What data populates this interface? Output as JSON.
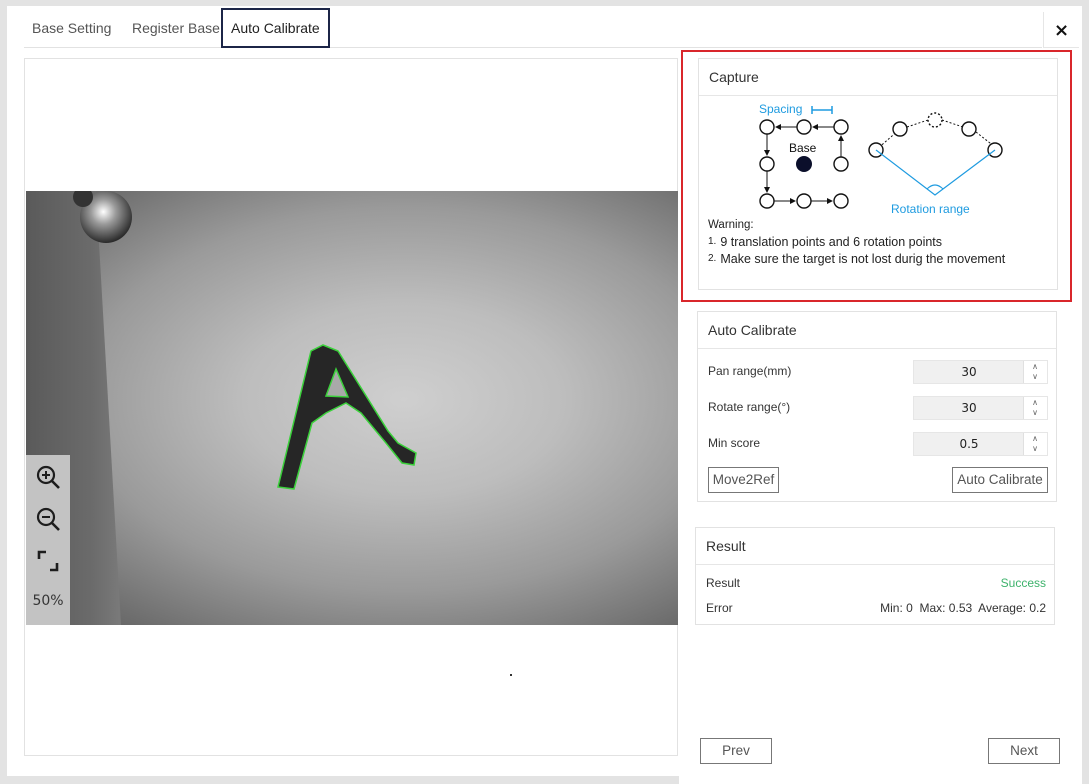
{
  "tabs": [
    {
      "label": "Base Setting"
    },
    {
      "label": "Register Base"
    },
    {
      "label": "Auto Calibrate"
    }
  ],
  "close_label": "×",
  "viewer": {
    "zoom_percent": "50%"
  },
  "capture": {
    "title": "Capture",
    "diagram": {
      "spacing_label": "Spacing",
      "base_label": "Base",
      "rotation_label": "Rotation range"
    },
    "warning_title": "Warning:",
    "warnings": [
      {
        "num": "1.",
        "text": "9 translation points and 6 rotation points"
      },
      {
        "num": "2.",
        "text": "Make sure the target is not lost durig the movement"
      }
    ]
  },
  "auto_calibrate": {
    "title": "Auto Calibrate",
    "fields": [
      {
        "label": "Pan range(mm)",
        "value": "30"
      },
      {
        "label": "Rotate range(°)",
        "value": "30"
      },
      {
        "label": "Min score",
        "value": "0.5"
      }
    ],
    "move2ref_label": "Move2Ref",
    "auto_calibrate_label": "Auto Calibrate"
  },
  "result": {
    "title": "Result",
    "result_label": "Result",
    "result_value": "Success",
    "error_label": "Error",
    "error_value": "Min: 0  Max: 0.53  Average: 0.2"
  },
  "nav": {
    "prev_label": "Prev",
    "next_label": "Next"
  },
  "colors": {
    "accent_blue": "#1e9be0",
    "success_green": "#3db26b",
    "highlight_red": "#d9262b"
  }
}
